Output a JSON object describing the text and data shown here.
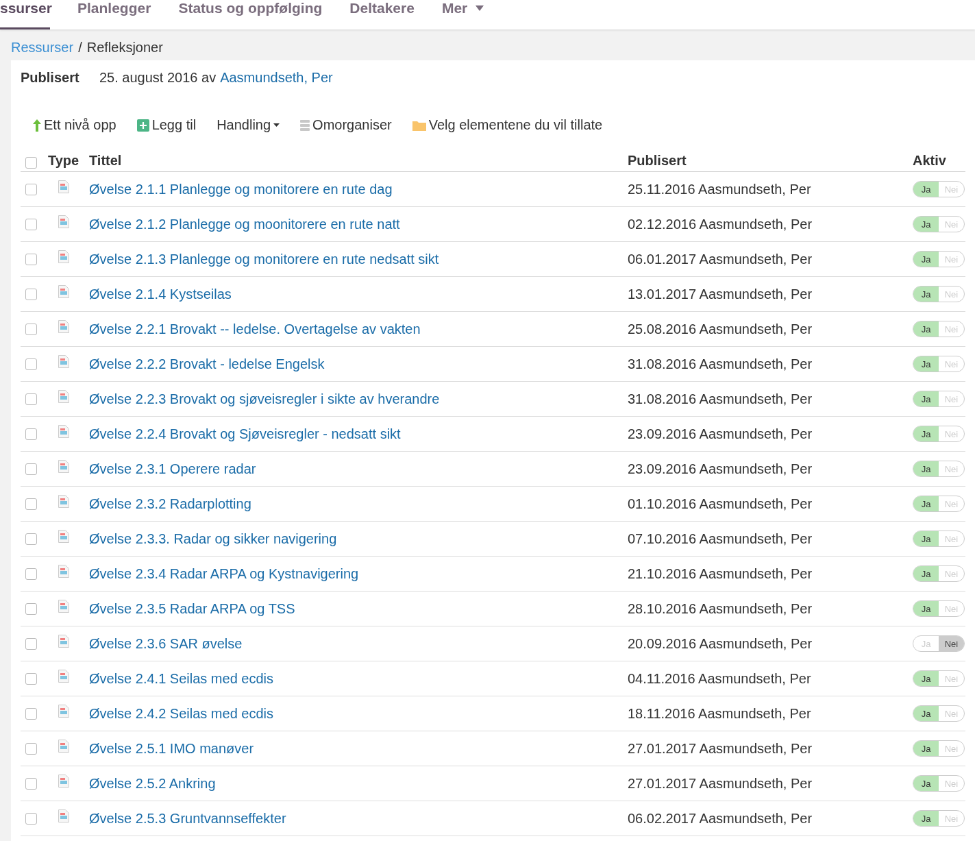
{
  "tabs": [
    {
      "label": "ssurser",
      "selected": true
    },
    {
      "label": "Planlegger",
      "selected": false
    },
    {
      "label": "Status og oppfølging",
      "selected": false
    },
    {
      "label": "Deltakere",
      "selected": false
    },
    {
      "label": "Mer",
      "selected": false,
      "dropdown": true
    }
  ],
  "breadcrumb": {
    "link": "Ressurser",
    "separator": "/",
    "current": "Refleksjoner"
  },
  "published": {
    "label": "Publisert",
    "text": "25. august 2016 av",
    "author": "Aasmundseth, Per"
  },
  "toolbar": [
    {
      "kind": "up",
      "label": "Ett nivå opp"
    },
    {
      "kind": "add",
      "label": "Legg til"
    },
    {
      "kind": "dropdown",
      "label": "Handling"
    },
    {
      "kind": "reorder",
      "label": "Omorganiser"
    },
    {
      "kind": "folder",
      "label": "Velg elementene du vil tillate"
    }
  ],
  "table": {
    "select_all": false,
    "columns": [
      "Type",
      "Tittel",
      "Publisert",
      "Aktiv"
    ],
    "rows": [
      {
        "checked": false,
        "title": "Øvelse 2.1.1 Planlegge og monitorere en rute dag",
        "published": "25.11.2016 Aasmundseth, Per",
        "active": true,
        "on_label": "Ja",
        "off_label": "Nei"
      },
      {
        "checked": false,
        "title": "Øvelse 2.1.2 Planlegge og moonitorere en rute natt",
        "published": "02.12.2016 Aasmundseth, Per",
        "active": true,
        "on_label": "Ja",
        "off_label": "Nei"
      },
      {
        "checked": false,
        "title": "Øvelse 2.1.3 Planlegge og monitorere en rute nedsatt sikt",
        "published": "06.01.2017 Aasmundseth, Per",
        "active": true,
        "on_label": "Ja",
        "off_label": "Nei"
      },
      {
        "checked": false,
        "title": "Øvelse 2.1.4 Kystseilas",
        "published": "13.01.2017 Aasmundseth, Per",
        "active": true,
        "on_label": "Ja",
        "off_label": "Nei"
      },
      {
        "checked": false,
        "title": "Øvelse 2.2.1 Brovakt -- ledelse. Overtagelse av vakten",
        "published": "25.08.2016 Aasmundseth, Per",
        "active": true,
        "on_label": "Ja",
        "off_label": "Nei"
      },
      {
        "checked": false,
        "title": "Øvelse 2.2.2 Brovakt - ledelse Engelsk",
        "published": "31.08.2016 Aasmundseth, Per",
        "active": true,
        "on_label": "Ja",
        "off_label": "Nei"
      },
      {
        "checked": false,
        "title": "Øvelse 2.2.3 Brovakt og sjøveisregler i sikte av hverandre",
        "published": "31.08.2016 Aasmundseth, Per",
        "active": true,
        "on_label": "Ja",
        "off_label": "Nei"
      },
      {
        "checked": false,
        "title": "Øvelse 2.2.4 Brovakt og Sjøveisregler - nedsatt sikt",
        "published": "23.09.2016 Aasmundseth, Per",
        "active": true,
        "on_label": "Ja",
        "off_label": "Nei"
      },
      {
        "checked": false,
        "title": "Øvelse 2.3.1 Operere radar",
        "published": "23.09.2016 Aasmundseth, Per",
        "active": true,
        "on_label": "Ja",
        "off_label": "Nei"
      },
      {
        "checked": false,
        "title": "Øvelse 2.3.2 Radarplotting",
        "published": "01.10.2016 Aasmundseth, Per",
        "active": true,
        "on_label": "Ja",
        "off_label": "Nei"
      },
      {
        "checked": false,
        "title": "Øvelse 2.3.3. Radar og sikker navigering",
        "published": "07.10.2016 Aasmundseth, Per",
        "active": true,
        "on_label": "Ja",
        "off_label": "Nei"
      },
      {
        "checked": false,
        "title": "Øvelse 2.3.4 Radar ARPA og Kystnavigering",
        "published": "21.10.2016 Aasmundseth, Per",
        "active": true,
        "on_label": "Ja",
        "off_label": "Nei"
      },
      {
        "checked": false,
        "title": "Øvelse 2.3.5 Radar ARPA og TSS",
        "published": "28.10.2016 Aasmundseth, Per",
        "active": true,
        "on_label": "Ja",
        "off_label": "Nei"
      },
      {
        "checked": false,
        "title": "Øvelse 2.3.6 SAR øvelse",
        "published": "20.09.2016 Aasmundseth, Per",
        "active": false,
        "on_label": "Ja",
        "off_label": "Nei"
      },
      {
        "checked": false,
        "title": "Øvelse 2.4.1 Seilas med ecdis",
        "published": "04.11.2016 Aasmundseth, Per",
        "active": true,
        "on_label": "Ja",
        "off_label": "Nei"
      },
      {
        "checked": false,
        "title": "Øvelse 2.4.2 Seilas med ecdis",
        "published": "18.11.2016 Aasmundseth, Per",
        "active": true,
        "on_label": "Ja",
        "off_label": "Nei"
      },
      {
        "checked": false,
        "title": "Øvelse 2.5.1 IMO manøver",
        "published": "27.01.2017 Aasmundseth, Per",
        "active": true,
        "on_label": "Ja",
        "off_label": "Nei"
      },
      {
        "checked": false,
        "title": "Øvelse 2.5.2 Ankring",
        "published": "27.01.2017 Aasmundseth, Per",
        "active": true,
        "on_label": "Ja",
        "off_label": "Nei"
      },
      {
        "checked": false,
        "title": "Øvelse 2.5.3 Gruntvannseffekter",
        "published": "06.02.2017 Aasmundseth, Per",
        "active": true,
        "on_label": "Ja",
        "off_label": "Nei"
      }
    ]
  }
}
